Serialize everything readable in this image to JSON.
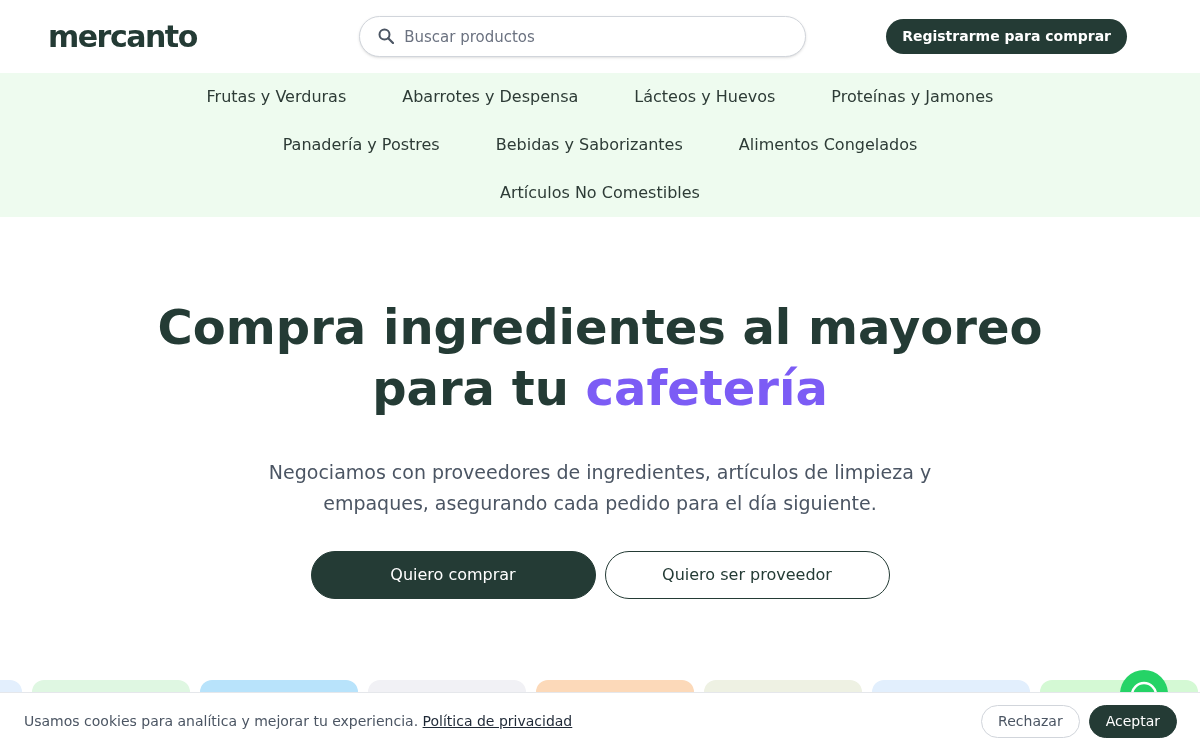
{
  "header": {
    "logo": "mercanto",
    "search": {
      "placeholder": "Buscar productos"
    },
    "register_button": "Registrarme para comprar"
  },
  "categories": [
    "Frutas y Verduras",
    "Abarrotes y Despensa",
    "Lácteos y Huevos",
    "Proteínas y Jamones",
    "Panadería y Postres",
    "Bebidas y Saborizantes",
    "Alimentos Congelados",
    "Artículos No Comestibles"
  ],
  "hero": {
    "title": "Compra ingredientes al mayoreo para tu",
    "title_highlight": "cafetería",
    "subtitle": "Negociamos con proveedores de ingredientes, artículos de limpieza y empaques, asegurando cada pedido para el día siguiente.",
    "buttons": [
      {
        "label": "Quiero comprar",
        "kind": "primary"
      },
      {
        "label": "Quiero ser proveedor",
        "kind": "outline"
      }
    ]
  },
  "category_cards": [
    {
      "color": "#e3effd"
    },
    {
      "color": "#dff7e2"
    },
    {
      "color": "#b8e3fb"
    },
    {
      "color": "#f1f1f5"
    },
    {
      "color": "#fcd9b9"
    },
    {
      "color": "#eef1e3"
    },
    {
      "color": "#e2effd"
    },
    {
      "color": "#d4f9d4"
    }
  ],
  "cookie_banner": {
    "message": "Usamos cookies para analítica y mejorar tu experiencia.",
    "link": "Política de privacidad",
    "buttons": [
      {
        "label": "Rechazar",
        "kind": "outline"
      },
      {
        "label": "Aceptar",
        "kind": "primary"
      }
    ]
  }
}
